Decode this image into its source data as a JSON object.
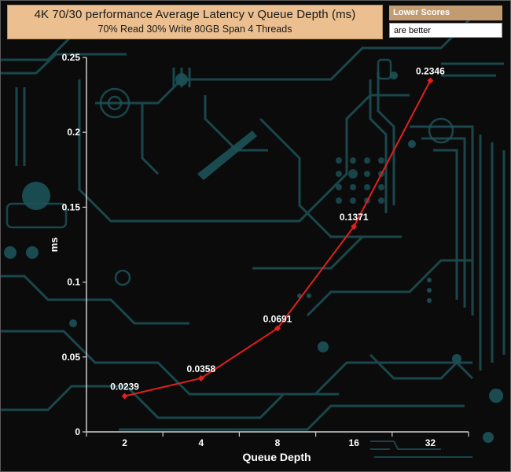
{
  "header": {
    "title": "4K 70/30 performance Average Latency v Queue Depth (ms)",
    "subtitle": "70% Read 30% Write 80GB Span 4 Threads"
  },
  "note": {
    "line1": "Lower Scores",
    "line2": "are better"
  },
  "colors": {
    "background": "#0b0b0b",
    "circuit": "#1c5258",
    "title_box": "#ebbf8f",
    "series_line": "#e02020",
    "axis": "#cfcfcf",
    "text": "#ffffff"
  },
  "chart_data": {
    "type": "line",
    "title": "4K 70/30 performance Average Latency v Queue Depth (ms)",
    "subtitle": "70% Read 30% Write 80GB Span 4 Threads",
    "xlabel": "Queue Depth",
    "ylabel": "ms",
    "categories": [
      "2",
      "4",
      "8",
      "16",
      "32"
    ],
    "series": [
      {
        "values": [
          0.0239,
          0.0358,
          0.0691,
          0.1371,
          0.2346
        ]
      }
    ],
    "data_labels": [
      "0.0239",
      "0.0358",
      "0.0691",
      "0.1371",
      "0.2346"
    ],
    "yticks": [
      "0",
      "0.05",
      "0.1",
      "0.15",
      "0.2",
      "0.25"
    ],
    "ylim": [
      0,
      0.25
    ],
    "grid": false,
    "legend": "none"
  }
}
